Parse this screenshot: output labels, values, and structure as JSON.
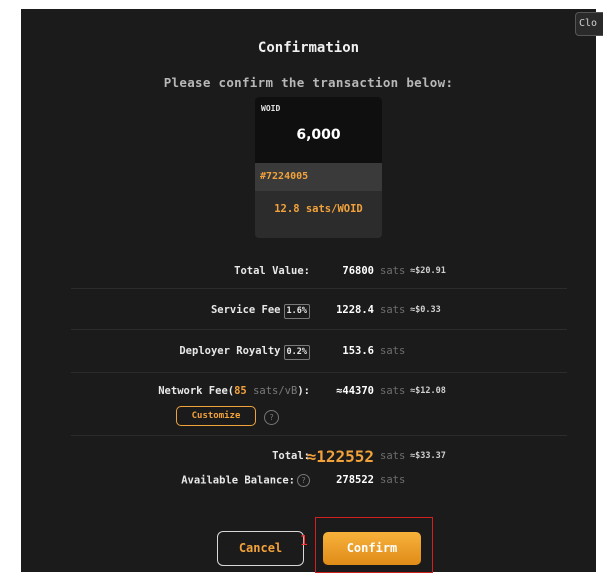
{
  "dialog": {
    "close_label": "Clo",
    "title": "Confirmation",
    "subtitle": "Please confirm the transaction below:"
  },
  "card": {
    "ticker": "WOID",
    "amount": "6,000",
    "inscription_id": "#7224005",
    "rate": "12.8 sats/WOID"
  },
  "summary": {
    "total_value": {
      "label": "Total Value:",
      "value": "76800",
      "unit": "sats",
      "usd": "≈$20.91"
    },
    "service_fee": {
      "label": "Service Fee",
      "badge": "1.6%",
      "value": "1228.4",
      "unit": "sats",
      "usd": "≈$0.33"
    },
    "deployer_royalty": {
      "label": "Deployer Royalty",
      "badge": "0.2%",
      "value": "153.6",
      "unit": "sats"
    },
    "network_fee": {
      "label_prefix": "Network Fee(",
      "rate": "85",
      "rate_unit": "sats/vB",
      "label_suffix": "):",
      "value": "≈44370",
      "unit": "sats",
      "usd": "≈$12.08",
      "customize_label": "Customize"
    },
    "total": {
      "label": "Total:",
      "value": "≈122552",
      "unit": "sats",
      "usd": "≈$33.37"
    },
    "available_balance": {
      "label": "Available Balance:",
      "value": "278522",
      "unit": "sats"
    },
    "help_glyph": "?"
  },
  "actions": {
    "cancel_label": "Cancel",
    "confirm_label": "Confirm",
    "marker": "1"
  },
  "colors": {
    "accent": "#f2a23a",
    "background": "#1b1b1b",
    "highlight": "#d21f1f"
  }
}
